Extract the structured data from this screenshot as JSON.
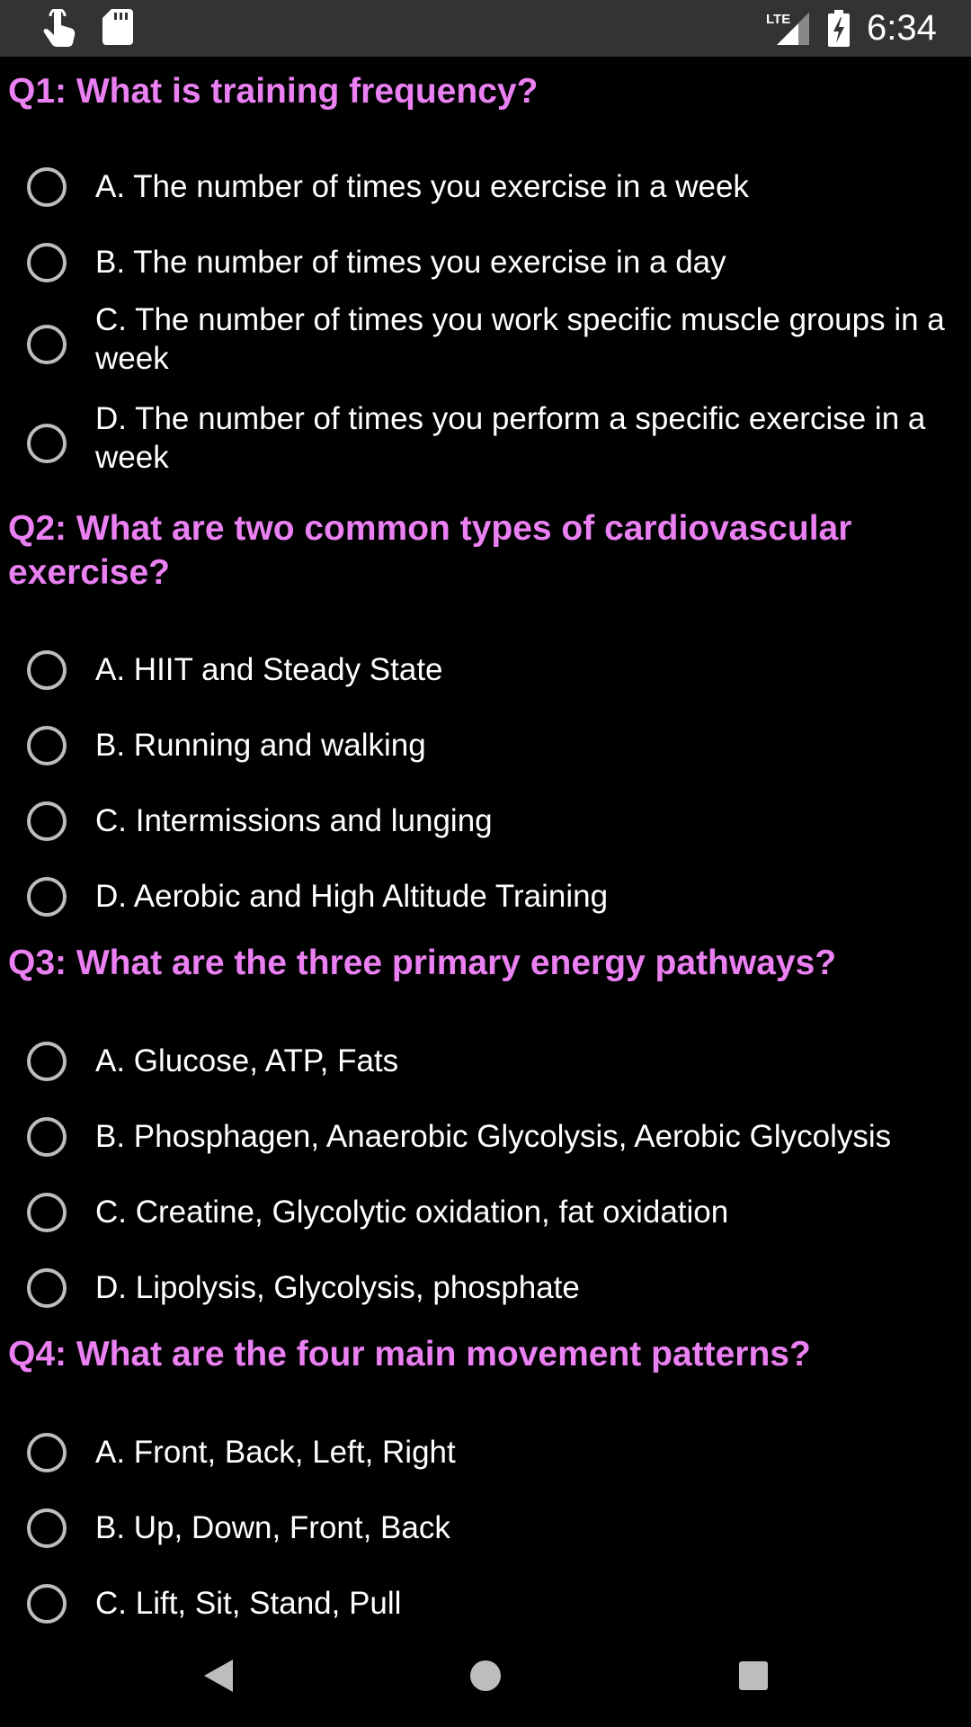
{
  "status_bar": {
    "time": "6:34",
    "network": "LTE",
    "icons": [
      "touch-hand-icon",
      "sd-card-icon",
      "lte-signal-icon",
      "battery-charging-icon"
    ]
  },
  "colors": {
    "question": "#ea80f2",
    "text": "#ffffff",
    "radio_border": "#bdbdbd",
    "status_bar_bg": "#333333",
    "background": "#000000"
  },
  "questions": [
    {
      "title": "Q1: What is training frequency?",
      "options": [
        "A. The number of times you exercise in a week",
        "B. The number of times you exercise in a day",
        "C. The number of times you work specific muscle groups in a week",
        "D. The number of times you perform a specific exercise in a week"
      ]
    },
    {
      "title": "Q2: What are two common types of cardiovascular exercise?",
      "options": [
        "A. HIIT and Steady State",
        "B. Running and walking",
        "C. Intermissions and lunging",
        "D. Aerobic and High Altitude Training"
      ]
    },
    {
      "title": "Q3: What are the three primary energy pathways?",
      "options": [
        "A. Glucose, ATP, Fats",
        "B. Phosphagen, Anaerobic Glycolysis, Aerobic Glycolysis",
        "C. Creatine, Glycolytic oxidation, fat oxidation",
        "D. Lipolysis, Glycolysis, phosphate"
      ]
    },
    {
      "title": "Q4: What are the four main movement patterns?",
      "options": [
        "A. Front, Back, Left, Right",
        "B. Up, Down, Front, Back",
        "C. Lift, Sit, Stand, Pull"
      ]
    }
  ],
  "nav_bar": {
    "icons": [
      "back-icon",
      "home-icon",
      "recents-icon"
    ]
  }
}
